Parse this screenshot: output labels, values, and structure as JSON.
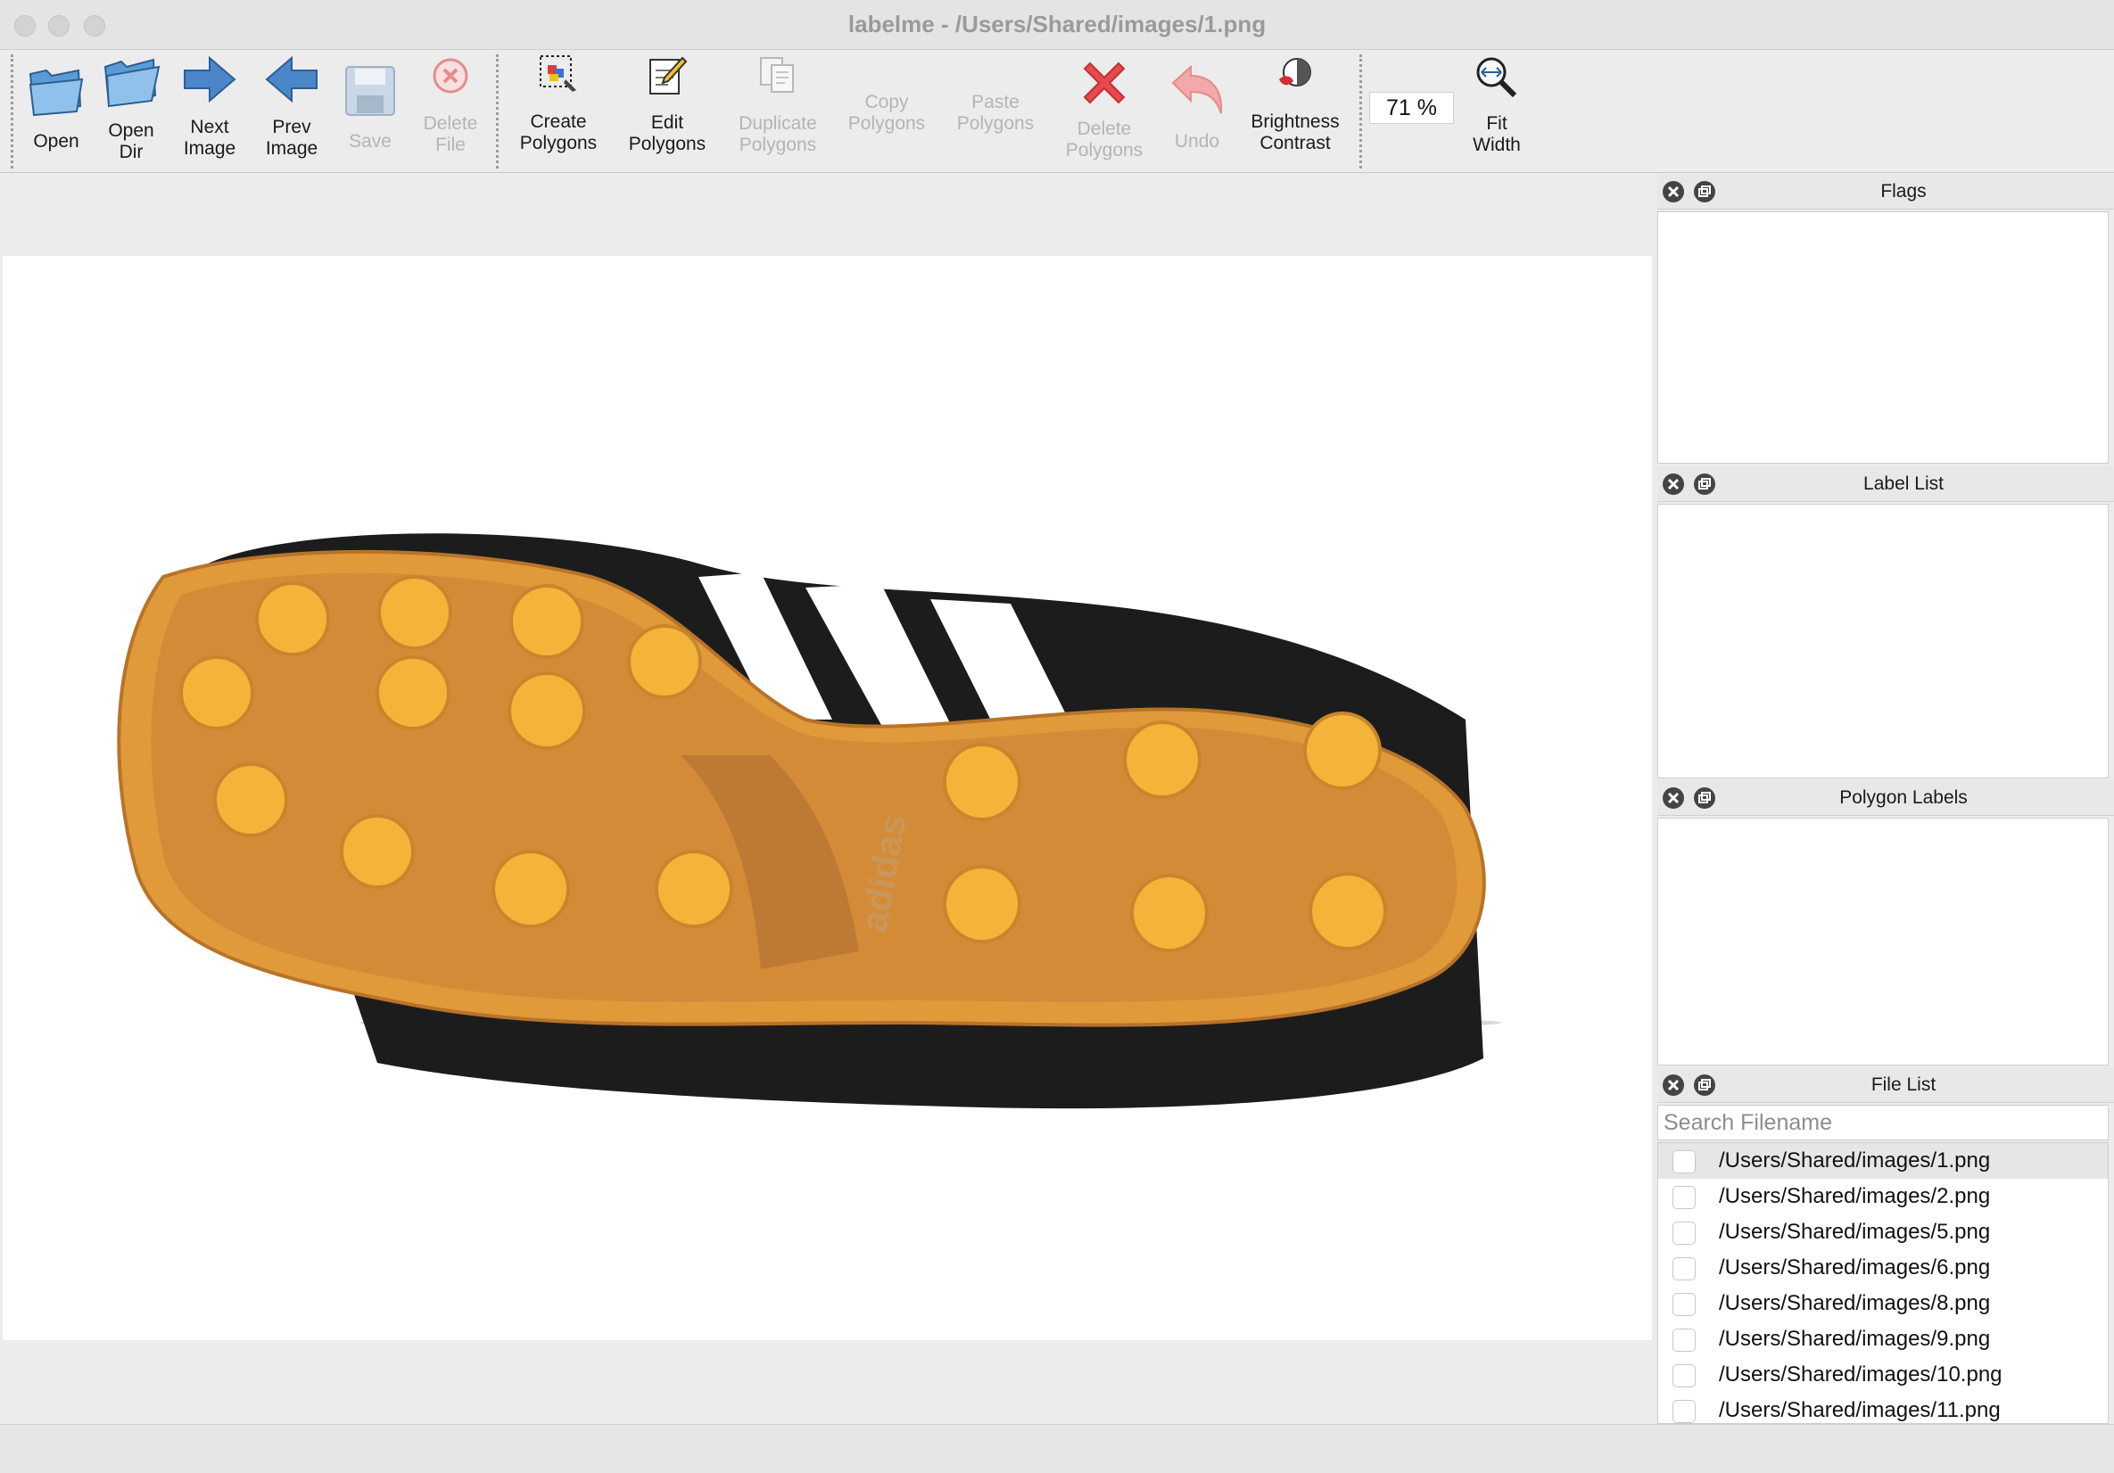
{
  "window": {
    "title": "labelme - /Users/Shared/images/1.png"
  },
  "toolbar": {
    "open": "Open",
    "open_dir": "Open\nDir",
    "next_image": "Next\nImage",
    "prev_image": "Prev\nImage",
    "save": "Save",
    "delete_file": "Delete\nFile",
    "create_polygons": "Create\nPolygons",
    "edit_polygons": "Edit\nPolygons",
    "duplicate_polygons": "Duplicate\nPolygons",
    "copy_polygons": "Copy\nPolygons",
    "paste_polygons": "Paste\nPolygons",
    "delete_polygons": "Delete\nPolygons",
    "undo": "Undo",
    "brightness_contrast": "Brightness\nContrast",
    "zoom_value": "71 %",
    "fit_width": "Fit\nWidth"
  },
  "docks": {
    "flags": "Flags",
    "label_list": "Label List",
    "polygon_labels": "Polygon Labels",
    "file_list": "File List"
  },
  "file_list": {
    "search_placeholder": "Search Filename",
    "files": [
      "/Users/Shared/images/1.png",
      "/Users/Shared/images/2.png",
      "/Users/Shared/images/5.png",
      "/Users/Shared/images/6.png",
      "/Users/Shared/images/8.png",
      "/Users/Shared/images/9.png",
      "/Users/Shared/images/10.png",
      "/Users/Shared/images/11.png"
    ]
  },
  "colors": {
    "accent_blue": "#4a86c8",
    "delete_red": "#e0393e",
    "sole_orange": "#e8a23c"
  },
  "icons": [
    "folder-open-icon",
    "folder-dir-icon",
    "arrow-right-icon",
    "arrow-left-icon",
    "floppy-icon",
    "delete-circle-icon",
    "create-polygon-icon",
    "edit-icon",
    "duplicate-icon",
    "delete-x-icon",
    "undo-icon",
    "brightness-icon",
    "zoom-fit-icon",
    "close-icon",
    "float-icon"
  ]
}
